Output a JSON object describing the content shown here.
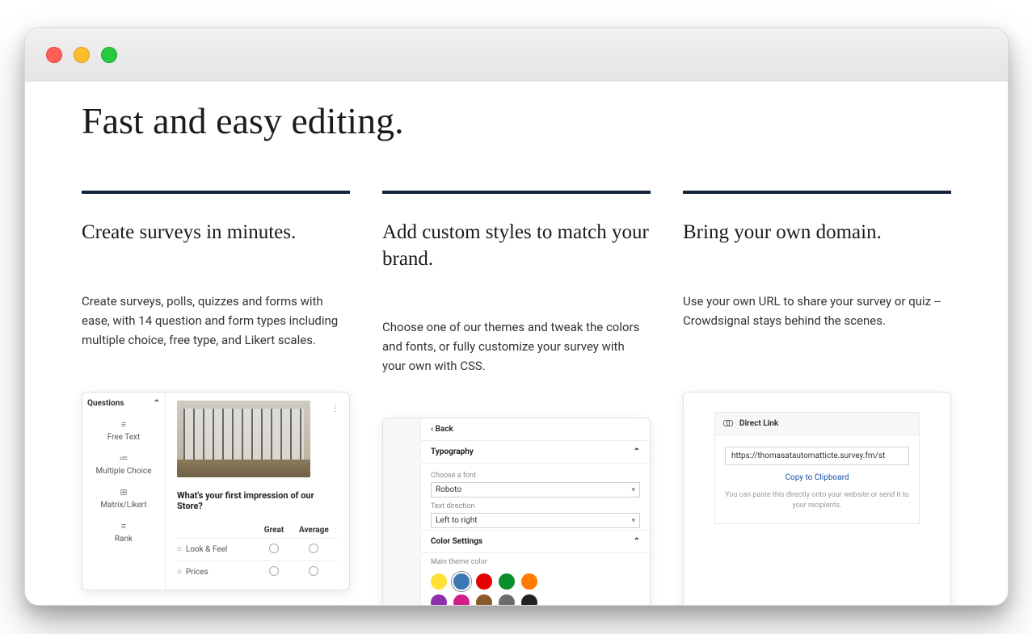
{
  "page": {
    "title": "Fast and easy editing."
  },
  "columns": [
    {
      "heading": "Create surveys in minutes.",
      "body": "Create surveys, polls, quizzes and forms with ease, with 14 question and form types including multiple choice, free type, and Likert scales."
    },
    {
      "heading": "Add custom styles to match your brand.",
      "body": "Choose one of our themes and tweak the colors and fonts, or fully customize your survey with your own with CSS."
    },
    {
      "heading": "Bring your own domain.",
      "body": "Use your own URL to share your survey or quiz -- Crowdsignal stays behind the scenes."
    }
  ],
  "card1": {
    "sidebar_title": "Questions",
    "types": [
      "Free Text",
      "Multiple Choice",
      "Matrix/Likert",
      "Rank"
    ],
    "question": "What's your first impression of our Store?",
    "matrix_cols": [
      "Great",
      "Average"
    ],
    "matrix_rows": [
      "Look & Feel",
      "Prices"
    ]
  },
  "card2": {
    "back": "Back",
    "typography": "Typography",
    "choose_font": "Choose a font",
    "font_value": "Roboto",
    "text_direction": "Text direction",
    "direction_value": "Left to right",
    "color_settings": "Color Settings",
    "main_theme_color": "Main theme color",
    "swatches_row1": [
      "#ffe135",
      "#3a77b3",
      "#e30000",
      "#0a8f2c",
      "#ff7a00"
    ],
    "swatches_row2": [
      "#8e2fae",
      "#d61b8a",
      "#8a5a2b",
      "#6d6d6d",
      "#222222"
    ],
    "selected_swatch": 1
  },
  "card3": {
    "title": "Direct Link",
    "url": "https://thomasatautomatticte.survey.fm/st",
    "copy": "Copy to Clipboard",
    "hint": "You can paste this directly onto your website or send it to your recipients."
  }
}
